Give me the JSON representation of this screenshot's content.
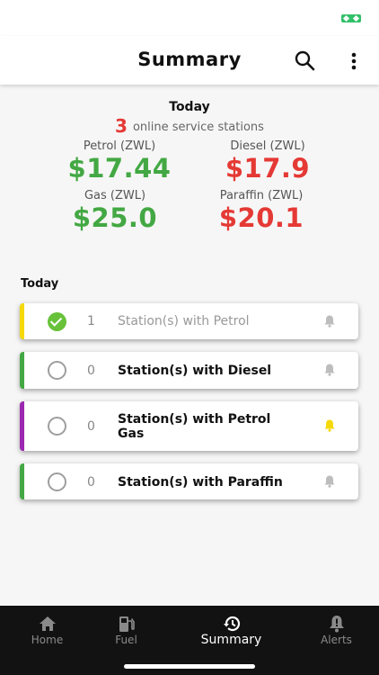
{
  "header": {
    "title": "Summary",
    "search_icon": "search-icon",
    "more_icon": "more-vert-icon"
  },
  "summary": {
    "date_label": "Today",
    "online_count": "3",
    "online_text": "online service stations",
    "prices": [
      {
        "label": "Petrol (ZWL)",
        "value": "$17.44",
        "color": "#43a843"
      },
      {
        "label": "Diesel (ZWL)",
        "value": "$17.9",
        "color": "#e53935"
      },
      {
        "label": "Gas (ZWL)",
        "value": "$25.0",
        "color": "#43a843"
      },
      {
        "label": "Paraffin (ZWL)",
        "value": "$20.1",
        "color": "#e53935"
      }
    ]
  },
  "list": {
    "heading": "Today",
    "rows": [
      {
        "count": "1",
        "label": "Station(s) with Petrol",
        "checked": true,
        "accent": "#f5d90a",
        "bell_active": false
      },
      {
        "count": "0",
        "label": "Station(s) with Diesel",
        "checked": false,
        "accent": "#43a843",
        "bell_active": false
      },
      {
        "count": "0",
        "label": "Station(s) with Petrol Gas",
        "checked": false,
        "accent": "#9c27b0",
        "bell_active": true
      },
      {
        "count": "0",
        "label": "Station(s) with Paraffin",
        "checked": false,
        "accent": "#43a843",
        "bell_active": false
      }
    ]
  },
  "bottom_nav": {
    "items": [
      {
        "label": "Home",
        "icon": "home-icon"
      },
      {
        "label": "Fuel",
        "icon": "fuel-pump-icon"
      },
      {
        "label": "Summary",
        "icon": "history-icon",
        "active": true
      },
      {
        "label": "Alerts",
        "icon": "alert-bell-icon"
      }
    ]
  },
  "colors": {
    "accent_green": "#43a843",
    "accent_red": "#e53935",
    "bell_active": "#f5d90a",
    "nav_bg": "#121212"
  }
}
